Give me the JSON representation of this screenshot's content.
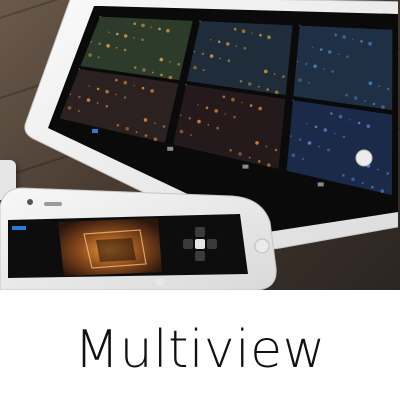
{
  "caption": "Multiview",
  "colors": {
    "background": "#ffffff",
    "device_frame": "#f2f2f2",
    "device_screen": "#0c0c0c",
    "caption_text": "#111111"
  },
  "ipad": {
    "tiles": [
      {
        "name": "night-city-tile-1",
        "tone": "#2d3b2a",
        "glow": "#e0a24a"
      },
      {
        "name": "night-city-tile-2",
        "tone": "#1f2c3a",
        "glow": "#d59a3c"
      },
      {
        "name": "night-city-tile-3",
        "tone": "#203044",
        "glow": "#4a84c7"
      },
      {
        "name": "night-city-tile-4",
        "tone": "#2a2120",
        "glow": "#e08a3a"
      },
      {
        "name": "night-city-tile-5",
        "tone": "#241a1c",
        "glow": "#e2893c"
      },
      {
        "name": "night-city-tile-6",
        "tone": "#1a2a48",
        "glow": "#5b86d8"
      }
    ],
    "tabbar_icons": [
      "grid-icon",
      "plus-icon",
      "window-icon",
      "gear-icon"
    ]
  },
  "iphone": {
    "video": {
      "name": "night-street-video",
      "tone": "#3a2314",
      "glow": "#e07a2a"
    },
    "controls": [
      "ptz-up-icon",
      "ptz-left-icon",
      "ptz-center-icon",
      "ptz-right-icon",
      "ptz-down-icon"
    ]
  }
}
